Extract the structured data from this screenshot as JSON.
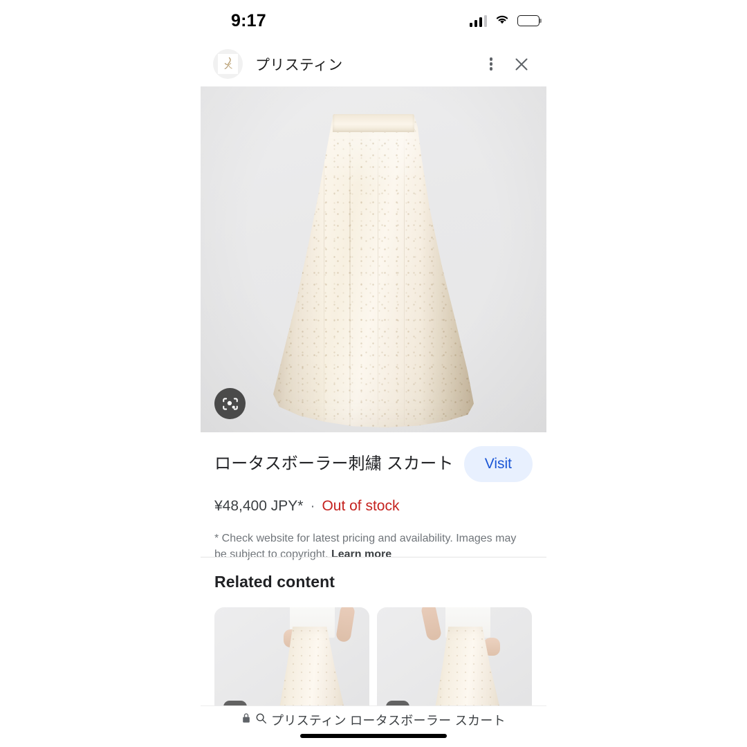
{
  "status_bar": {
    "time": "9:17",
    "cellular_icon": "cellular-signal-icon",
    "wifi_icon": "wifi-icon",
    "battery_icon": "battery-full-icon"
  },
  "header": {
    "site_name": "プリスティン",
    "avatar_icon": "site-favicon",
    "menu_icon": "more-options-kebab-icon",
    "close_icon": "close-x-icon"
  },
  "hero": {
    "lens_icon": "google-lens-camera-icon",
    "image_alt": "ivory eyelet lace midi skirt on light gray background"
  },
  "product": {
    "title": "ロータスボーラー刺繍 スカート",
    "visit_label": "Visit",
    "price": "¥48,400 JPY*",
    "separator": "·",
    "stock_status": "Out of stock",
    "disclaimer_text": "* Check website for latest pricing and availability. Images may be subject to copyright. ",
    "learn_more_label": "Learn more"
  },
  "related": {
    "heading": "Related content",
    "cards": [
      {
        "alt": "model wearing ivory lace skirt, front view",
        "badge_icon": "image-tag-icon"
      },
      {
        "alt": "model wearing ivory lace skirt, side view with hand in pocket",
        "badge_icon": "image-tag-icon"
      }
    ]
  },
  "bottom_bar": {
    "lock_icon": "secure-lock-icon",
    "search_icon": "search-magnifier-icon",
    "query": "プリスティン ロータスボーラー スカート"
  },
  "colors": {
    "accent_blue": "#1a56d6",
    "visit_bg": "#e8f0fe",
    "out_of_stock_red": "#c5221f",
    "text_primary": "#202124",
    "text_secondary": "#70757a"
  }
}
